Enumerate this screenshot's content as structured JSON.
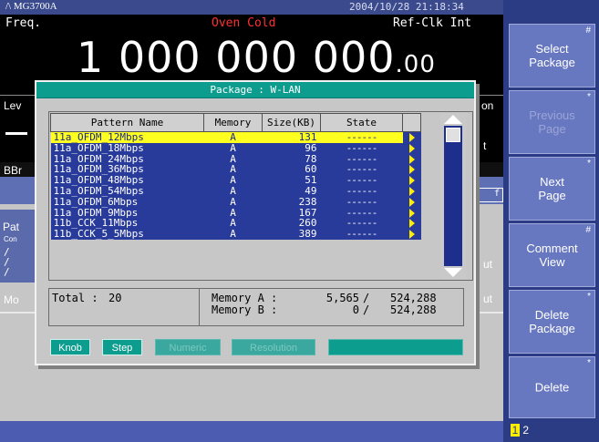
{
  "header": {
    "logo": "/\\ MG3700A",
    "datetime": "2004/10/28  21:18:34",
    "freq_label": "Freq.",
    "oven_status": "Oven Cold",
    "ref_clk": "Ref-Clk Int",
    "freq_main": "1 000 000 000",
    "freq_fraction": ".00"
  },
  "background": {
    "lev_label": "Lev",
    "on_label": "on",
    "t_label": "t",
    "bbr_label": "BBr",
    "pat_label": "Pat",
    "con_label": "Con",
    "mode_label": "Mo",
    "ut1_label": "ut",
    "ut2_label": "ut",
    "f_label": "f",
    "slash": "/"
  },
  "dialog": {
    "title": "Package : W-LAN",
    "columns": [
      "Pattern Name",
      "Memory",
      "Size(KB)",
      "State"
    ],
    "rows": [
      {
        "name": "11a_OFDM_12Mbps",
        "memory": "A",
        "size": "131",
        "state": "------"
      },
      {
        "name": "11a_OFDM_18Mbps",
        "memory": "A",
        "size": "96",
        "state": "------"
      },
      {
        "name": "11a_OFDM_24Mbps",
        "memory": "A",
        "size": "78",
        "state": "------"
      },
      {
        "name": "11a_OFDM_36Mbps",
        "memory": "A",
        "size": "60",
        "state": "------"
      },
      {
        "name": "11a_OFDM_48Mbps",
        "memory": "A",
        "size": "51",
        "state": "------"
      },
      {
        "name": "11a_OFDM_54Mbps",
        "memory": "A",
        "size": "49",
        "state": "------"
      },
      {
        "name": "11a_OFDM_6Mbps",
        "memory": "A",
        "size": "238",
        "state": "------"
      },
      {
        "name": "11a_OFDM_9Mbps",
        "memory": "A",
        "size": "167",
        "state": "------"
      },
      {
        "name": "11b_CCK_11Mbps",
        "memory": "A",
        "size": "260",
        "state": "------"
      },
      {
        "name": "11b_CCK_5_5Mbps",
        "memory": "A",
        "size": "389",
        "state": "------"
      }
    ],
    "selected_index": 0,
    "scroll_position": 0.0,
    "summary": {
      "total_label": "Total :",
      "total_value": "20",
      "mem_a_label": "Memory A :",
      "mem_a_used": "5,565",
      "mem_a_total": "524,288",
      "mem_b_label": "Memory B :",
      "mem_b_used": "0",
      "mem_b_total": "524,288",
      "separator": "/"
    },
    "modes": {
      "knob": "Knob",
      "step": "Step",
      "numeric": "Numeric",
      "resolution": "Resolution"
    }
  },
  "softkeys": [
    {
      "label_line1": "Select",
      "label_line2": "Package",
      "mark": "#",
      "enabled": true
    },
    {
      "label_line1": "Previous",
      "label_line2": "Page",
      "mark": "*",
      "enabled": false
    },
    {
      "label_line1": "Next",
      "label_line2": "Page",
      "mark": "*",
      "enabled": true
    },
    {
      "label_line1": "Comment",
      "label_line2": "View",
      "mark": "#",
      "enabled": true
    },
    {
      "label_line1": "Delete",
      "label_line2": "Package",
      "mark": "*",
      "enabled": true
    },
    {
      "label_line1": "Delete",
      "label_line2": "",
      "mark": "*",
      "enabled": true
    }
  ],
  "page_indicator": {
    "current": "1",
    "next": "2"
  },
  "colors": {
    "dialog_teal": "#0c9d8f",
    "table_blue": "#283a9a",
    "highlight_yellow": "#ffff20",
    "oven_red": "#ff3030"
  }
}
